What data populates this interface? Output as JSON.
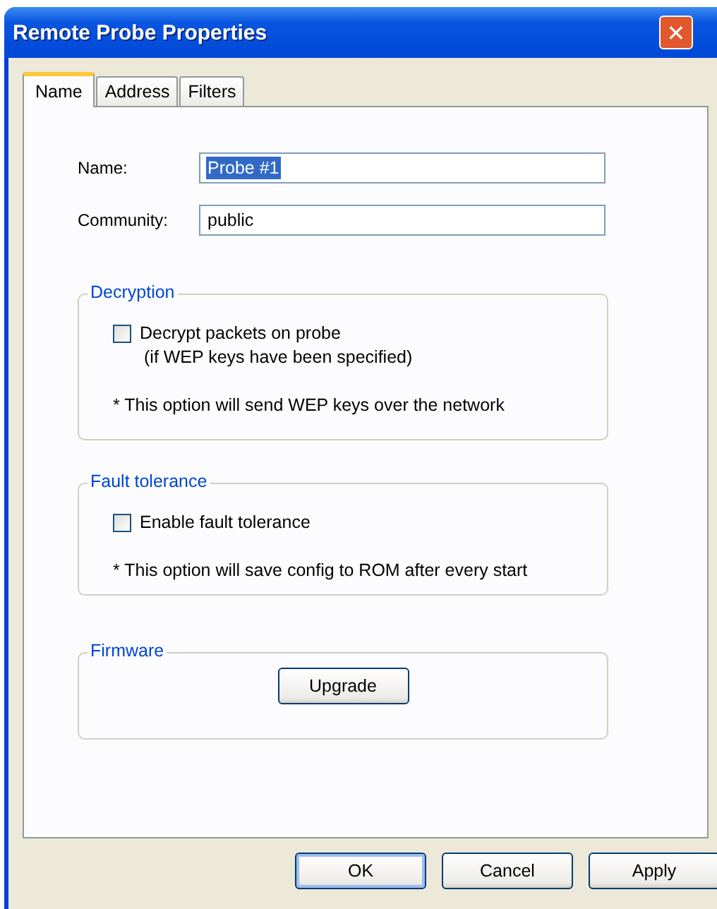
{
  "window": {
    "title": "Remote Probe Properties",
    "close_icon": "✕"
  },
  "tabs": [
    {
      "label": "Name",
      "selected": true
    },
    {
      "label": "Address",
      "selected": false
    },
    {
      "label": "Filters",
      "selected": false
    }
  ],
  "fields": [
    {
      "label": "Name:",
      "value": "Probe #1",
      "text_selected": true
    },
    {
      "label": "Community:",
      "value": "public",
      "text_selected": false
    }
  ],
  "groups": [
    {
      "title": "Decryption",
      "checkbox": {
        "label": "Decrypt packets on probe",
        "sublabel": "(if WEP keys have been specified)",
        "checked": false
      },
      "note": "* This option will send WEP keys over the network"
    },
    {
      "title": "Fault tolerance",
      "checkbox": {
        "label": "Enable fault tolerance",
        "checked": false
      },
      "note": "* This option will save config to ROM after every start"
    },
    {
      "title": "Firmware",
      "button": "Upgrade"
    }
  ],
  "buttons": [
    {
      "label": "OK",
      "default": true
    },
    {
      "label": "Cancel",
      "default": false
    },
    {
      "label": "Apply",
      "default": false
    }
  ]
}
